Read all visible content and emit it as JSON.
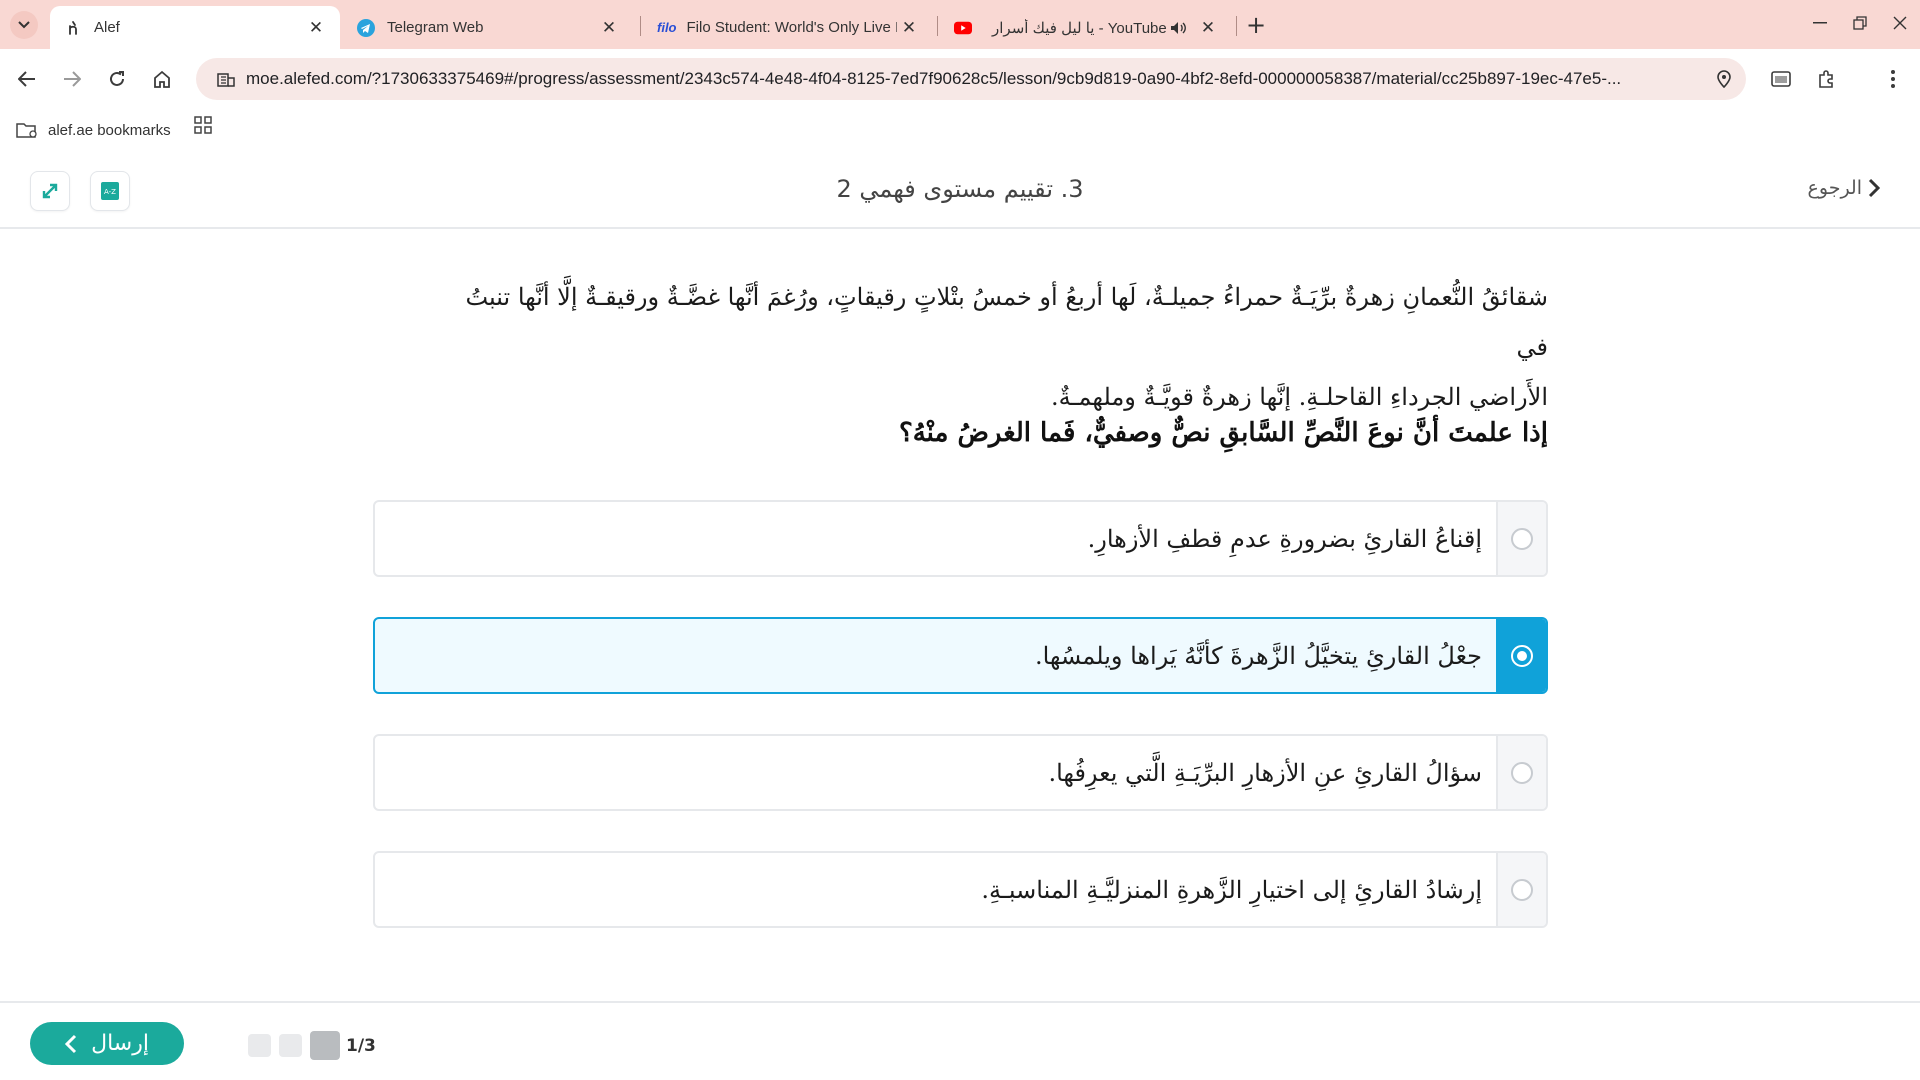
{
  "browser": {
    "tabs": [
      {
        "title": "Alef",
        "active": true
      },
      {
        "title": "Telegram Web",
        "active": false
      },
      {
        "title": "Filo Student: World's Only Live I",
        "active": false,
        "favicon_text": "filo"
      },
      {
        "title": "YouTube - يا ليل فيك أسرار",
        "active": false
      }
    ],
    "url": "moe.alefed.com/?1730633375469#/progress/assessment/2343c574-4e48-4f04-8125-7ed7f90628c5/lesson/9cb9d819-0a90-4bf2-8efd-000000058387/material/cc25b897-19ec-47e5-...",
    "bookmark": "alef.ae bookmarks"
  },
  "header": {
    "title": "3. تقييم مستوى فهمي 2",
    "back_label": "الرجوع"
  },
  "passage": {
    "line1": "شقائقُ النُّعمانِ زهرةٌ برِّيَـةٌ حمراءُ جميلـةٌ، لَها أربعُ أو خمسُ بتْلاتٍ رقيقاتٍ، ورُغمَ أنَّها غضَّـةٌ ورقيقـةٌ إلَّا أنَّها تنبتُ في",
    "line2": "الأَراضي الجرداءِ القاحلـةِ. إنَّها زهرةٌ قويَّـةٌ وملهمـةٌ."
  },
  "question": "إذا علمتَ أنَّ نوعَ النَّصِّ السَّابقِ نصٌّ وصفيٌّ، فَما الغرضُ منْهُ؟",
  "options": [
    {
      "text": "إقناعُ القارئِ بضرورةِ عدمِ قطفِ الأزهارِ.",
      "selected": false
    },
    {
      "text": "جعْلُ القارئِ يتخيَّلُ الزَّهرةَ كأنَّهُ يَراها ويلمسُها.",
      "selected": true
    },
    {
      "text": "سؤالُ القارئِ عنِ الأزهارِ البرِّيَـةِ الَّتي يعرِفُها.",
      "selected": false
    },
    {
      "text": "إرشادُ القارئِ إلى اختيارِ الزَّهرةِ المنزليَّـةِ المناسبـةِ.",
      "selected": false
    }
  ],
  "footer": {
    "submit_label": "إرسال",
    "page_count": "1/3"
  },
  "colors": {
    "accent": "#10a2d9",
    "submit": "#1baa9c",
    "tabbar": "#f9d8d3"
  }
}
